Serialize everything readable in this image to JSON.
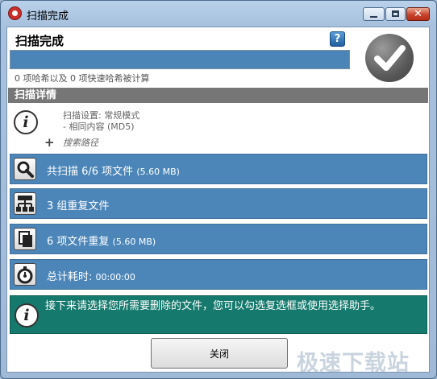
{
  "window": {
    "title": "扫描完成",
    "min_glyph": "",
    "close_glyph": "✕"
  },
  "header": {
    "title": "扫描完成",
    "help_glyph": "?",
    "progress_fraction": 1.0,
    "hash_status": "0 项哈希以及 0 项快速哈希被计算"
  },
  "details": {
    "title": "扫描详情",
    "info_glyph": "i",
    "settings_line1": "扫描设置: 常规模式",
    "settings_line2": "- 相同内容 (MD5)",
    "plus_glyph": "+",
    "search_path_label": "搜索路径"
  },
  "results": [
    {
      "icon": "magnifier-icon",
      "label": "共扫描 6/6 项文件 ",
      "detail": "(5.60 MB)"
    },
    {
      "icon": "hierarchy-icon",
      "label": "3 组重复文件",
      "detail": ""
    },
    {
      "icon": "copy-files-icon",
      "label": "6 项文件重复 ",
      "detail": "(5.60 MB)"
    },
    {
      "icon": "stopwatch-icon",
      "label": "总计耗时: ",
      "detail": "00:00:00"
    }
  ],
  "next_step": {
    "info_glyph": "i",
    "text": "接下来请选择您所需要删除的文件，您可以勾选复选框或使用选择助手。"
  },
  "footer": {
    "close_label": "关闭",
    "watermark": "极速下载站"
  },
  "colors": {
    "row_blue": "#4c86b9",
    "teal": "#157a6d",
    "section_gray": "#767676"
  }
}
